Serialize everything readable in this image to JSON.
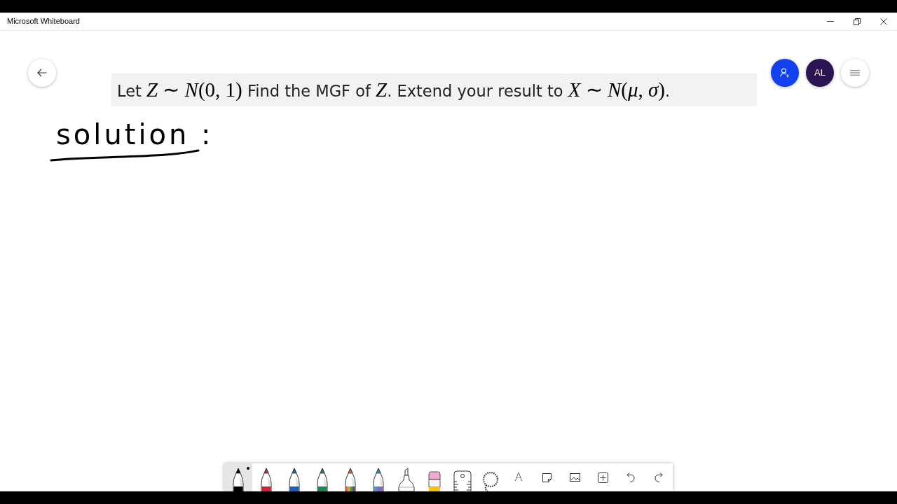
{
  "window": {
    "title": "Microsoft Whiteboard"
  },
  "question": {
    "segments": [
      {
        "kind": "text",
        "text": "Let "
      },
      {
        "kind": "math",
        "text": "*Z* ∼ *N*(0, 1)"
      },
      {
        "kind": "text",
        "text": " Find the MGF of "
      },
      {
        "kind": "math",
        "text": "*Z*"
      },
      {
        "kind": "text",
        "text": ". Extend your result to "
      },
      {
        "kind": "math",
        "text": "*X* ∼ *N*(*μ*, *σ*)"
      },
      {
        "kind": "text",
        "text": "."
      }
    ]
  },
  "handwriting": {
    "text": "solution :"
  },
  "avatar": {
    "initials": "AL"
  },
  "toolbar": {
    "tools": [
      {
        "kind": "pen",
        "color": "#000000",
        "selected": true
      },
      {
        "kind": "pen",
        "color": "#d0213a",
        "selected": false
      },
      {
        "kind": "pen",
        "color": "#1b5fc1",
        "selected": false
      },
      {
        "kind": "pen",
        "color": "#1a8a4a",
        "selected": false
      },
      {
        "kind": "rainbow-pen",
        "selected": false
      },
      {
        "kind": "galaxy-pen",
        "selected": false
      },
      {
        "kind": "highlighter",
        "selected": false
      },
      {
        "kind": "eraser",
        "selected": false
      },
      {
        "kind": "ruler",
        "selected": false
      },
      {
        "kind": "lasso",
        "selected": false
      },
      {
        "kind": "text",
        "label": "A",
        "selected": false
      },
      {
        "kind": "note",
        "selected": false
      },
      {
        "kind": "image",
        "selected": false
      },
      {
        "kind": "insert",
        "selected": false
      },
      {
        "kind": "undo",
        "selected": false
      },
      {
        "kind": "redo",
        "selected": false
      }
    ]
  }
}
